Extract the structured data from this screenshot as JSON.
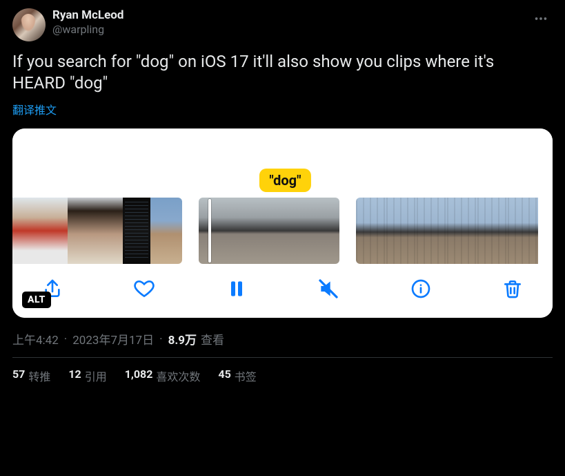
{
  "author": {
    "display_name": "Ryan McLeod",
    "handle": "@warpling"
  },
  "tweet_text": "If you search for \"dog\" on iOS 17 it'll also show you clips where it's HEARD \"dog\"",
  "translate_label": "翻译推文",
  "media": {
    "search_tag": "\"dog\"",
    "alt_badge": "ALT"
  },
  "meta": {
    "time": "上午4:42",
    "date": "2023年7月17日",
    "views_count": "8.9万",
    "views_label": "查看"
  },
  "stats": {
    "retweets_count": "57",
    "retweets_label": "转推",
    "quotes_count": "12",
    "quotes_label": "引用",
    "likes_count": "1,082",
    "likes_label": "喜欢次数",
    "bookmarks_count": "45",
    "bookmarks_label": "书签"
  }
}
